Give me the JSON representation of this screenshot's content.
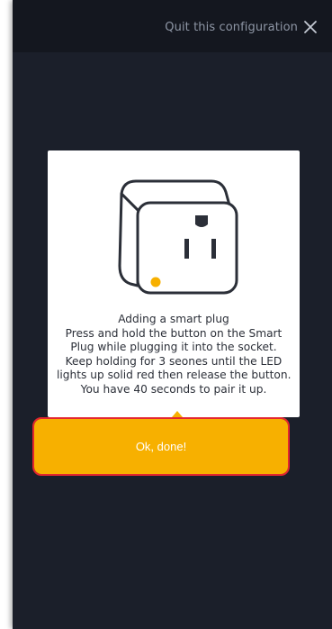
{
  "header": {
    "quit_label": "Quit this configuration",
    "quit_icon": "close-icon"
  },
  "dialog": {
    "illustration_icon": "smart-plug-icon",
    "led_color": "#f7b000",
    "message_lines": [
      "Adding a smart plug",
      "Press and hold the button on the Smart",
      "Plug while plugging it into the socket.",
      "Keep holding for 3 seones until the LED",
      "lights up solid red then release the button.",
      "You have 40 seconds to pair it up."
    ],
    "ok_label": "Ok, done!"
  },
  "colors": {
    "background": "#1b1f2a",
    "accent": "#f7b000",
    "highlight": "#e3262f"
  }
}
